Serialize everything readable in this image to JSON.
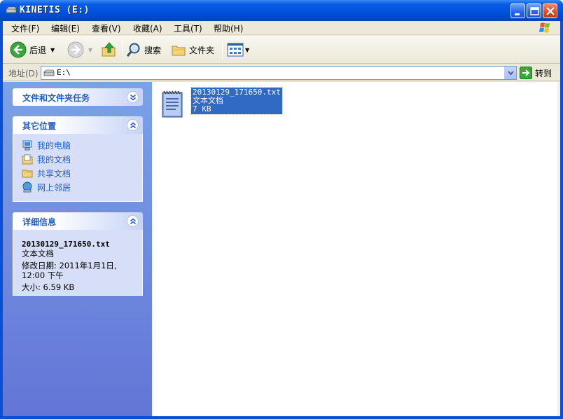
{
  "window": {
    "title": "KINETIS (E:)",
    "minimize_icon": "minimize-icon",
    "maximize_icon": "maximize-icon",
    "close_icon": "close-icon"
  },
  "menubar": {
    "items": [
      "文件(F)",
      "编辑(E)",
      "查看(V)",
      "收藏(A)",
      "工具(T)",
      "帮助(H)"
    ]
  },
  "toolbar": {
    "back_label": "后退",
    "search_label": "搜索",
    "folders_label": "文件夹"
  },
  "address": {
    "label": "地址(D)",
    "value": "E:\\",
    "go_label": "转到"
  },
  "sidebar": {
    "file_tasks": {
      "title": "文件和文件夹任务"
    },
    "other_places": {
      "title": "其它位置",
      "items": [
        {
          "label": "我的电脑",
          "icon": "computer-icon"
        },
        {
          "label": "我的文档",
          "icon": "documents-icon"
        },
        {
          "label": "共享文档",
          "icon": "shared-folder-icon"
        },
        {
          "label": "网上邻居",
          "icon": "network-icon"
        }
      ]
    },
    "details": {
      "title": "详细信息",
      "name": "20130129_171650.txt",
      "type": "文本文档",
      "modified_line1": "修改日期: 2011年1月1日,",
      "modified_line2": "12:00 下午",
      "size": "大小: 6.59 KB"
    }
  },
  "files": [
    {
      "name": "20130129_171650.txt",
      "type": "文本文档",
      "size": "7 KB",
      "icon": "text-document-icon",
      "selected": true
    }
  ],
  "colors": {
    "titlebar": "#0152dc",
    "sidebar_top": "#7ba2e7",
    "sidebar_bottom": "#6375d6",
    "link": "#215dc6",
    "selection": "#316ac5"
  }
}
